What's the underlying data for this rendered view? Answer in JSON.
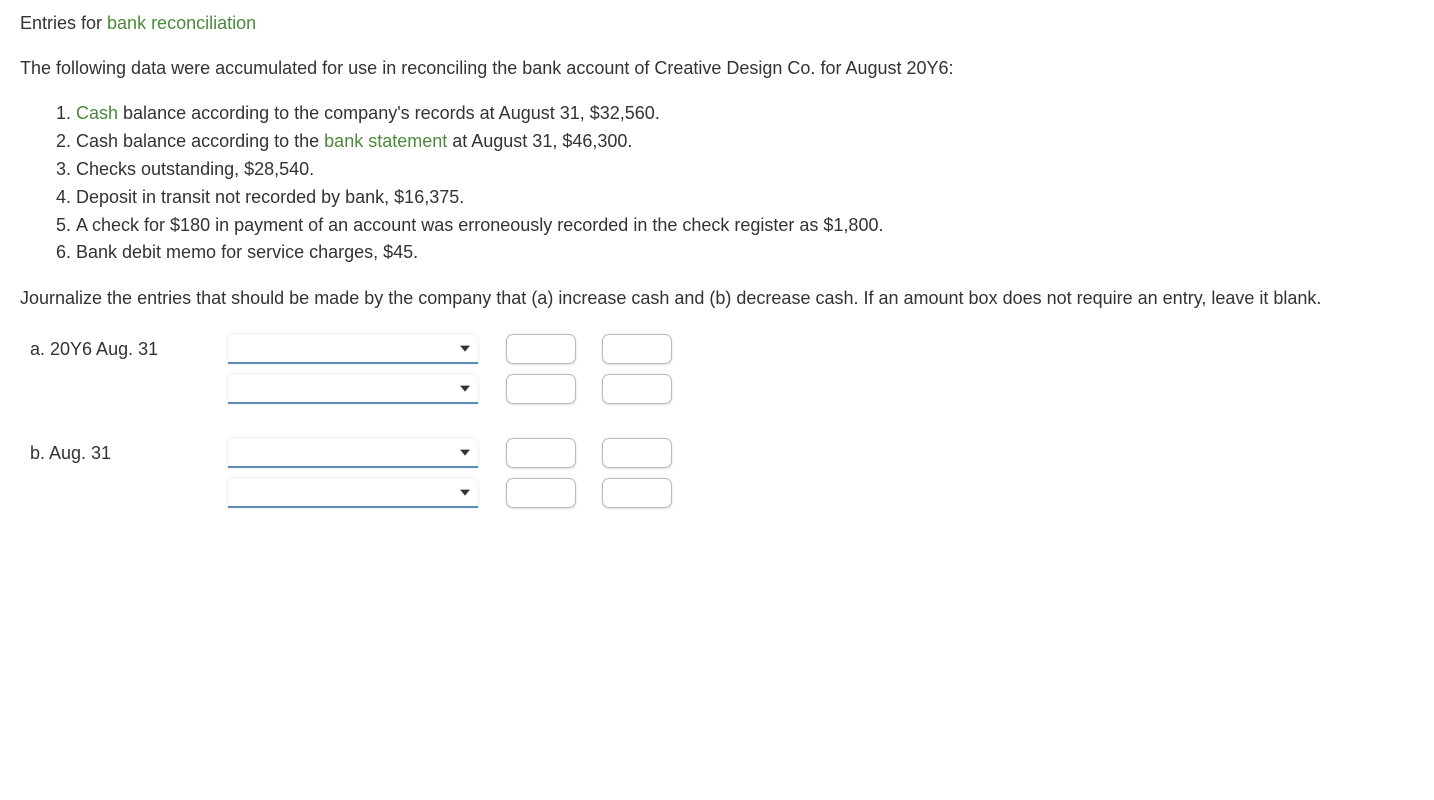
{
  "title": {
    "prefix": "Entries for ",
    "keyword": "bank reconciliation"
  },
  "intro": "The following data were accumulated for use in reconciling the bank account of Creative Design Co. for August 20Y6:",
  "list": {
    "item1": {
      "keyword": "Cash",
      "rest": " balance according to the company's records at August 31, $32,560."
    },
    "item2": {
      "before": "Cash balance according to the ",
      "keyword": "bank statement",
      "after": " at August 31, $46,300."
    },
    "item3": "Checks outstanding, $28,540.",
    "item4": "Deposit in transit not recorded by bank, $16,375.",
    "item5": "A check for $180 in payment of an account was erroneously recorded in the check register as $1,800.",
    "item6": "Bank debit memo for service charges, $45."
  },
  "instruction": "Journalize the entries that should be made by the company that (a) increase cash and (b) decrease cash. If an amount box does not require an entry, leave it blank.",
  "entries": {
    "a": {
      "label": "a. 20Y6 Aug. 31"
    },
    "b": {
      "label": "b. Aug. 31"
    }
  }
}
